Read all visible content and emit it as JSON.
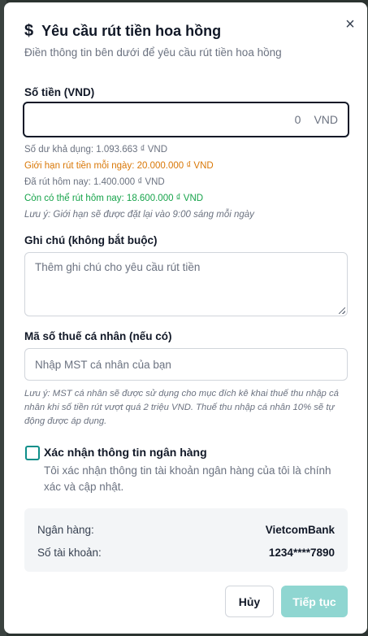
{
  "dialog": {
    "title": "Yêu cầu rút tiền hoa hồng",
    "subtitle": "Điền thông tin bên dưới để yêu cầu rút tiền hoa hồng",
    "close_symbol": "×"
  },
  "amount": {
    "label": "Số tiền (VND)",
    "value": "0",
    "unit": "VND"
  },
  "balance_info": {
    "available": "Số dư khả dụng: 1.093.663 ₫ VND",
    "daily_limit": "Giới hạn rút tiền mỗi ngày: 20.000.000 ₫ VND",
    "withdrawn_today": "Đã rút hôm nay: 1.400.000 ₫ VND",
    "remaining_today": "Còn có thể rút hôm nay: 18.600.000 ₫ VND",
    "reset_note": "Lưu ý: Giới hạn sẽ được đặt lại vào 9:00 sáng mỗi ngày"
  },
  "note_field": {
    "label": "Ghi chú (không bắt buộc)",
    "placeholder": "Thêm ghi chú cho yêu cầu rút tiền"
  },
  "tax_field": {
    "label": "Mã số thuế cá nhân (nếu có)",
    "placeholder": "Nhập MST cá nhân của bạn",
    "note": "Lưu ý: MST cá nhân sẽ được sử dụng cho mục đích kê khai thuế thu nhập cá nhân khi số tiền rút vượt quá 2 triệu VND. Thuế thu nhập cá nhân 10% sẽ tự động được áp dụng."
  },
  "confirm": {
    "title": "Xác nhận thông tin ngân hàng",
    "description": "Tôi xác nhận thông tin tài khoản ngân hàng của tôi là chính xác và cập nhật.",
    "checked": false
  },
  "bank": {
    "bank_label": "Ngân hàng:",
    "bank_value": "VietcomBank",
    "account_label": "Số tài khoản:",
    "account_value": "1234****7890"
  },
  "actions": {
    "cancel_label": "Hủy",
    "continue_label": "Tiếp tục"
  },
  "colors": {
    "accent": "#0f8f8a",
    "continue_disabled": "#8fd6d1",
    "warning": "#d97706",
    "success": "#16a34a"
  },
  "icons": {
    "title_icon": "dollar-icon",
    "close_icon": "close-icon",
    "checkbox": "checkbox-icon"
  }
}
